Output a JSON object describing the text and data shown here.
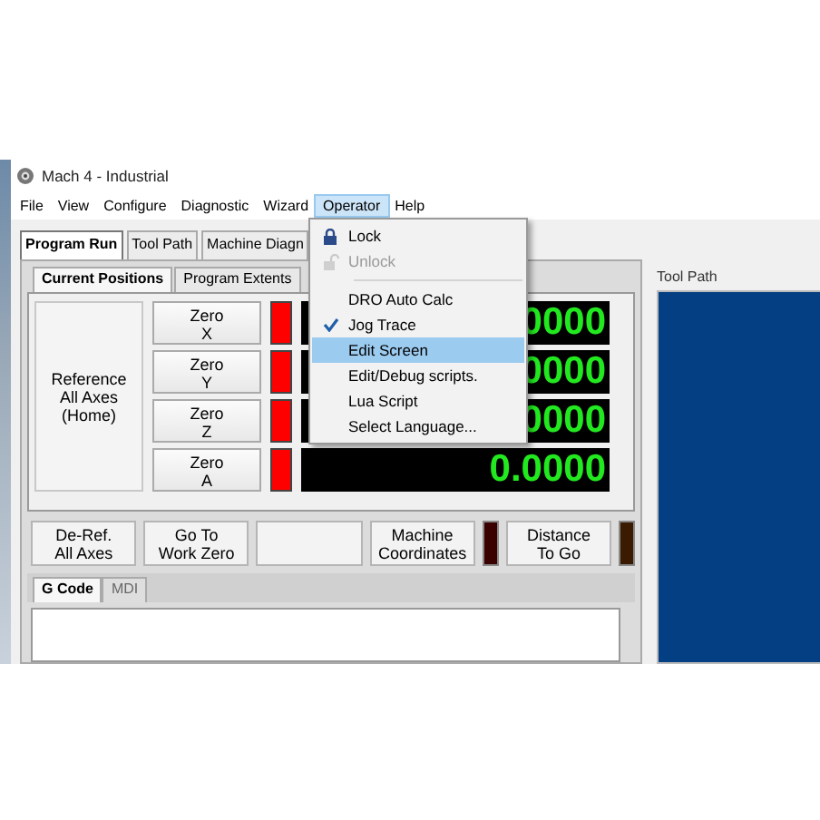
{
  "window": {
    "title": "Mach 4 - Industrial"
  },
  "menu": [
    {
      "label": "File",
      "selected": false
    },
    {
      "label": "View",
      "selected": false
    },
    {
      "label": "Configure",
      "selected": false
    },
    {
      "label": "Diagnostic",
      "selected": false
    },
    {
      "label": "Wizard",
      "selected": false
    },
    {
      "label": "Operator",
      "selected": true
    },
    {
      "label": "Help",
      "selected": false
    }
  ],
  "tabs": [
    {
      "label": "Program Run",
      "selected": true
    },
    {
      "label": "Tool Path",
      "selected": false
    },
    {
      "label": "Machine Diagn",
      "selected": false
    }
  ],
  "position_tabs": [
    {
      "label": "Current Positions",
      "selected": true
    },
    {
      "label": "Program Extents",
      "selected": false
    }
  ],
  "reference_button": "Reference\nAll Axes\n(Home)",
  "axes": [
    {
      "zero_button": "Zero\nX",
      "color": "#ff0000",
      "dro": "0000"
    },
    {
      "zero_button": "Zero\nY",
      "color": "#ff0000",
      "dro": "0000"
    },
    {
      "zero_button": "Zero\nZ",
      "color": "#ff0000",
      "dro": "0000"
    },
    {
      "zero_button": "Zero\nA",
      "color": "#ff0000",
      "dro": "0.0000"
    }
  ],
  "bottom_controls": [
    {
      "kind": "button",
      "label": "De-Ref.\nAll Axes"
    },
    {
      "kind": "button",
      "label": "Go To\nWork Zero"
    },
    {
      "kind": "blank"
    },
    {
      "kind": "button",
      "label": "Machine\nCoordinates"
    },
    {
      "kind": "indicator",
      "color": "#3a0000"
    },
    {
      "kind": "button",
      "label": "Distance\nTo Go"
    },
    {
      "kind": "indicator",
      "color": "#3a1a00"
    }
  ],
  "code_tabs": [
    {
      "label": "G Code",
      "selected": true
    },
    {
      "label": "MDI",
      "selected": false
    }
  ],
  "tool_path": {
    "title": "Tool Path"
  },
  "operator_menu": {
    "items": [
      {
        "kind": "lock",
        "label": "Lock",
        "disabled": false,
        "checked": false,
        "selected": false
      },
      {
        "kind": "unlock",
        "label": "Unlock",
        "disabled": true,
        "checked": false,
        "selected": false
      },
      {
        "kind": "separator"
      },
      {
        "kind": "item",
        "label": "DRO Auto Calc",
        "disabled": false,
        "checked": false,
        "selected": false
      },
      {
        "kind": "item",
        "label": "Jog Trace",
        "disabled": false,
        "checked": true,
        "selected": false
      },
      {
        "kind": "item",
        "label": "Edit Screen",
        "disabled": false,
        "checked": false,
        "selected": true
      },
      {
        "kind": "item",
        "label": "Edit/Debug scripts.",
        "disabled": false,
        "checked": false,
        "selected": false
      },
      {
        "kind": "item",
        "label": "Lua Script",
        "disabled": false,
        "checked": false,
        "selected": false
      },
      {
        "kind": "item",
        "label": "Select Language...",
        "disabled": false,
        "checked": false,
        "selected": false
      }
    ]
  }
}
